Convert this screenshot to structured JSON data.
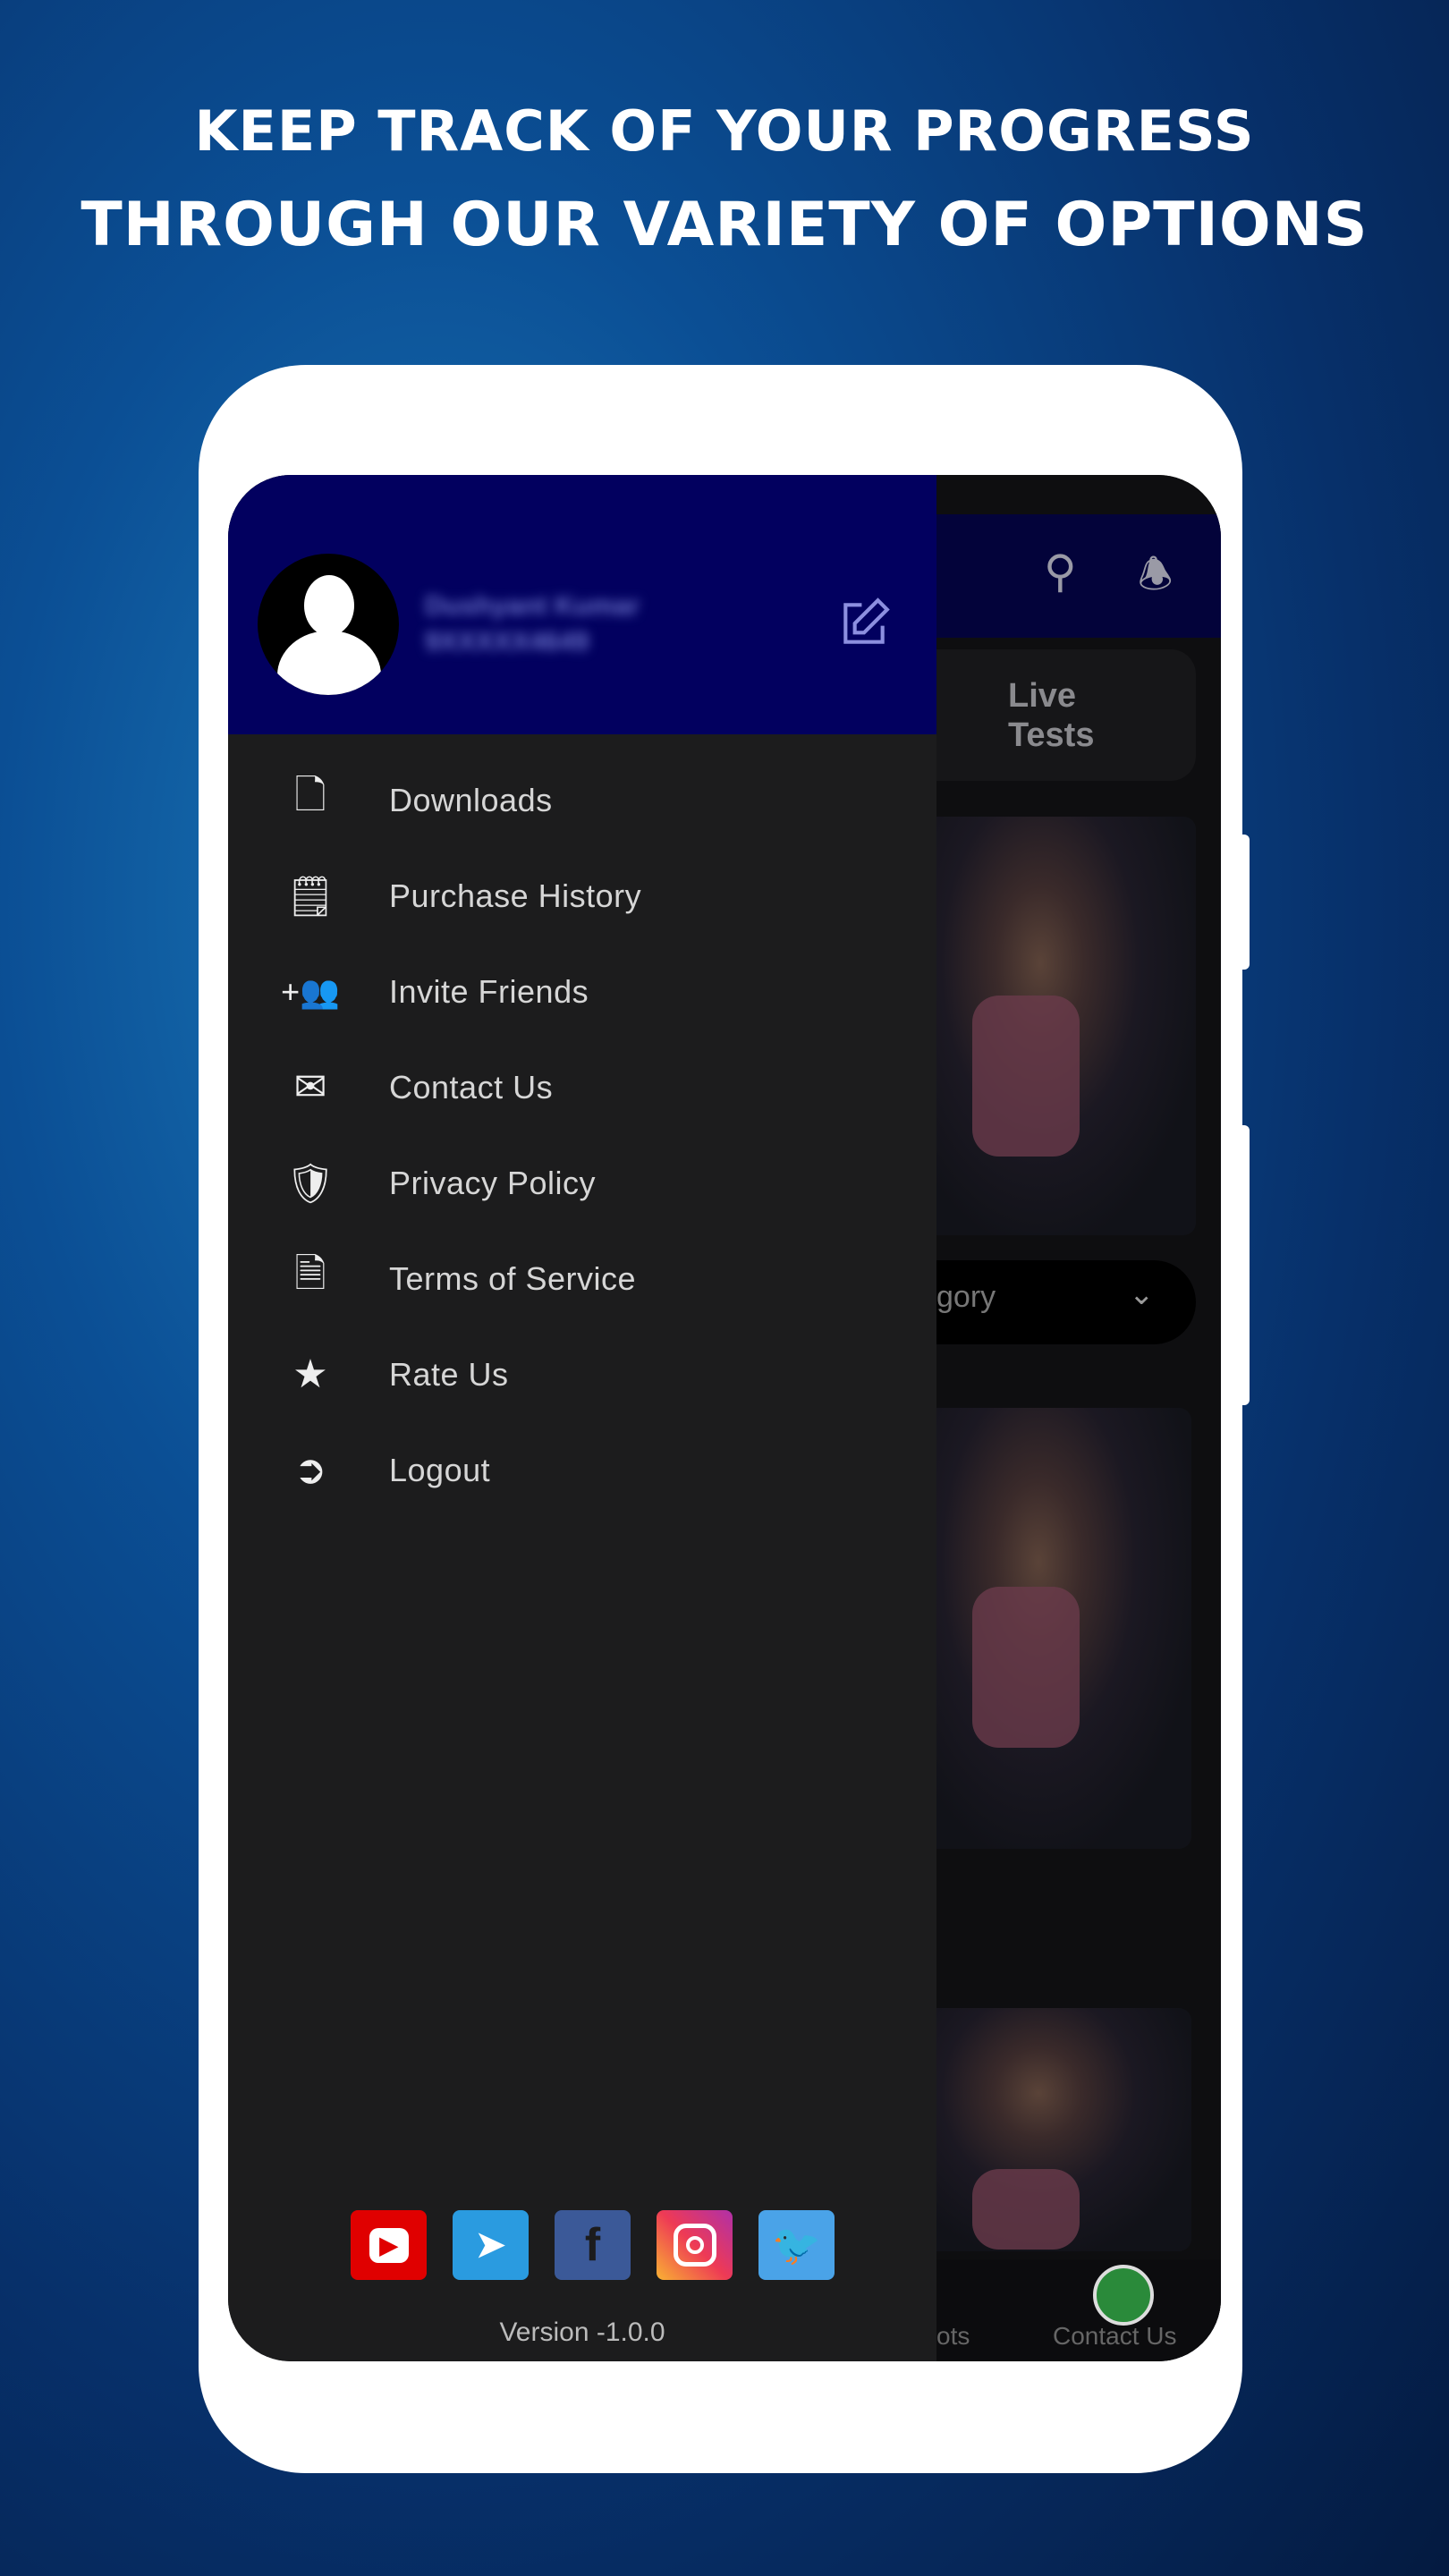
{
  "headline": {
    "line1": "KEEP TRACK OF YOUR PROGRESS",
    "line2": "THROUGH OUR VARIETY OF OPTIONS"
  },
  "background_app": {
    "live_tests": "Live Tests",
    "category_fragment": "gory",
    "bottom_nav": {
      "left_fragment": "ots",
      "contact": "Contact Us"
    }
  },
  "drawer": {
    "user": {
      "name": "Dushyant Kumar",
      "phone": "9XXXXX4649"
    },
    "items": [
      {
        "label": "Downloads",
        "icon": "download-file-icon"
      },
      {
        "label": "Purchase History",
        "icon": "purchase-history-icon"
      },
      {
        "label": "Invite Friends",
        "icon": "add-users-icon"
      },
      {
        "label": "Contact Us",
        "icon": "contact-mail-icon"
      },
      {
        "label": "Privacy Policy",
        "icon": "shield-document-icon"
      },
      {
        "label": "Terms of Service",
        "icon": "terms-document-icon"
      },
      {
        "label": "Rate Us",
        "icon": "star-icon"
      },
      {
        "label": "Logout",
        "icon": "logout-icon"
      }
    ],
    "social": [
      {
        "name": "YouTube",
        "color": "#e00000"
      },
      {
        "name": "Telegram",
        "color": "#2a9be0"
      },
      {
        "name": "Facebook",
        "color": "#3b5998"
      },
      {
        "name": "Instagram",
        "color": "#e4405f"
      },
      {
        "name": "Twitter",
        "color": "#4aa3e8"
      }
    ],
    "version": "Version -1.0.0"
  },
  "colors": {
    "drawer_header": "#02005f",
    "drawer_bg": "#1c1c1d"
  }
}
